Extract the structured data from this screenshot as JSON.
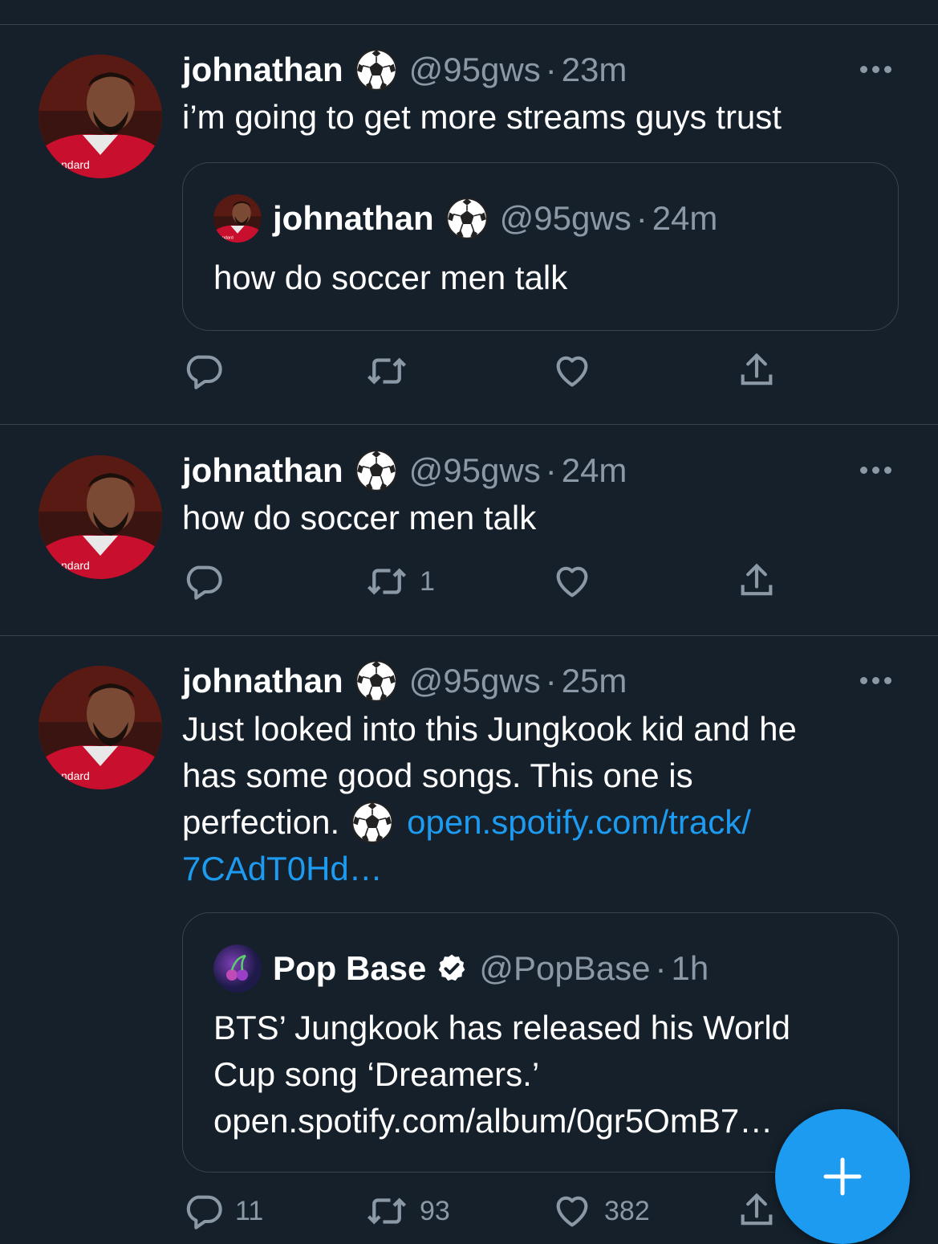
{
  "colors": {
    "background": "#15202b",
    "divider": "#38444d",
    "secondary_text": "#8b98a5",
    "link": "#1d9bf0",
    "accent": "#1d9bf0"
  },
  "tweets": [
    {
      "name": "johnathan",
      "name_emoji": "soccer-ball-icon",
      "handle": "@95gws",
      "sep": "·",
      "time": "23m",
      "text": "i’m going to get more streams guys trust",
      "quote": {
        "name": "johnathan",
        "handle": "@95gws",
        "sep": "·",
        "time": "24m",
        "text": "how do soccer men talk"
      },
      "actions": {
        "reply": "",
        "retweet": "",
        "like": ""
      }
    },
    {
      "name": "johnathan",
      "name_emoji": "soccer-ball-icon",
      "handle": "@95gws",
      "sep": "·",
      "time": "24m",
      "text": "how do soccer men talk",
      "actions": {
        "reply": "",
        "retweet": "1",
        "like": ""
      }
    },
    {
      "name": "johnathan",
      "name_emoji": "soccer-ball-icon",
      "handle": "@95gws",
      "sep": "·",
      "time": "25m",
      "text_line1": "Just looked into this Jungkook kid and he",
      "text_line2": "has some good songs. This one is",
      "text_line3_pre": "perfection.",
      "text_link1": "open.spotify.com/track/",
      "text_link2": "7CAdT0Hd…",
      "quote": {
        "name": "Pop Base",
        "handle": "@PopBase",
        "sep": "·",
        "time": "1h",
        "line1": "BTS’ Jungkook has released his World",
        "line2": "Cup song ‘Dreamers.’",
        "line3": "open.spotify.com/album/0gr5OmB7…"
      },
      "actions": {
        "reply": "11",
        "retweet": "93",
        "like": "382"
      }
    }
  ]
}
